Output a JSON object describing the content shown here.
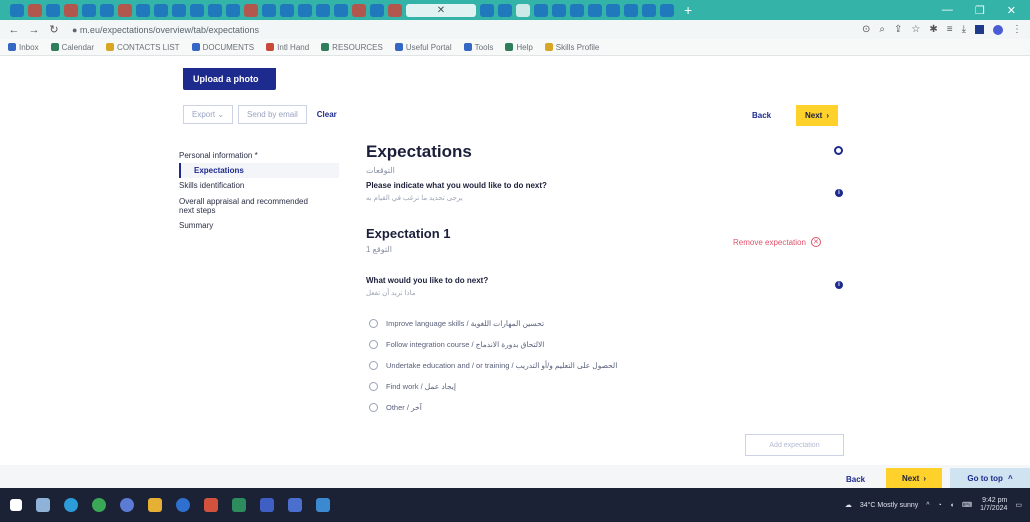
{
  "browser": {
    "url": "● m.eu/expectations/overview/tab/expectations",
    "bookmarks": [
      "Inbox",
      "Calendar",
      "CONTACTS LIST",
      "DOCUMENTS",
      "Intl Hand",
      "RESOURCES",
      "Useful Portal",
      "Tools",
      "Help",
      "Skills Profile"
    ],
    "window_controls": [
      "—",
      "❐",
      "✕"
    ]
  },
  "page": {
    "upload_photo": "Upload a photo",
    "toolbar": {
      "export": "Export ⌄",
      "send_by_email": "Send by email",
      "clear": "Clear"
    },
    "top_back": "Back",
    "top_next": "Next",
    "sidebar": [
      {
        "label": "Personal information *",
        "active": false
      },
      {
        "label": "Expectations",
        "active": true
      },
      {
        "label": "Skills identification",
        "active": false
      },
      {
        "label": "Overall appraisal and recommended next steps",
        "active": false
      },
      {
        "label": "Summary",
        "active": false
      }
    ],
    "section_title": "Expectations",
    "section_title_ar": "التوقعات",
    "question_main": "Please indicate what you would like to do next?",
    "question_main_ar": "يرجى تحديد ما ترغب في القيام به",
    "expectation_title": "Expectation 1",
    "expectation_title_ar": "التوقع 1",
    "remove_expectation": "Remove expectation",
    "question_next": "What would you like to do next?",
    "question_next_ar": "ماذا تريد أن تفعل",
    "options": [
      "Improve language skills / تحسين المهارات اللغوية",
      "Follow integration course / الالتحاق بدورة الاندماج",
      "Undertake education and / or training / الحصول على التعليم و/أو التدريب",
      "Find work / إيجاد عمل",
      "Other / آخر"
    ],
    "add_expectation": "Add expectation",
    "bottom_back": "Back",
    "bottom_next": "Next",
    "go_to_top": "Go to top"
  },
  "taskbar": {
    "weather": "34°C  Mostly sunny",
    "time": "9:42 pm",
    "date": "1/7/2024"
  },
  "colors": {
    "brand_blue": "#1d2b8f",
    "accent_yellow": "#ffd12b",
    "remove_red": "#e0536b",
    "tabstrip": "#34b3a8"
  }
}
